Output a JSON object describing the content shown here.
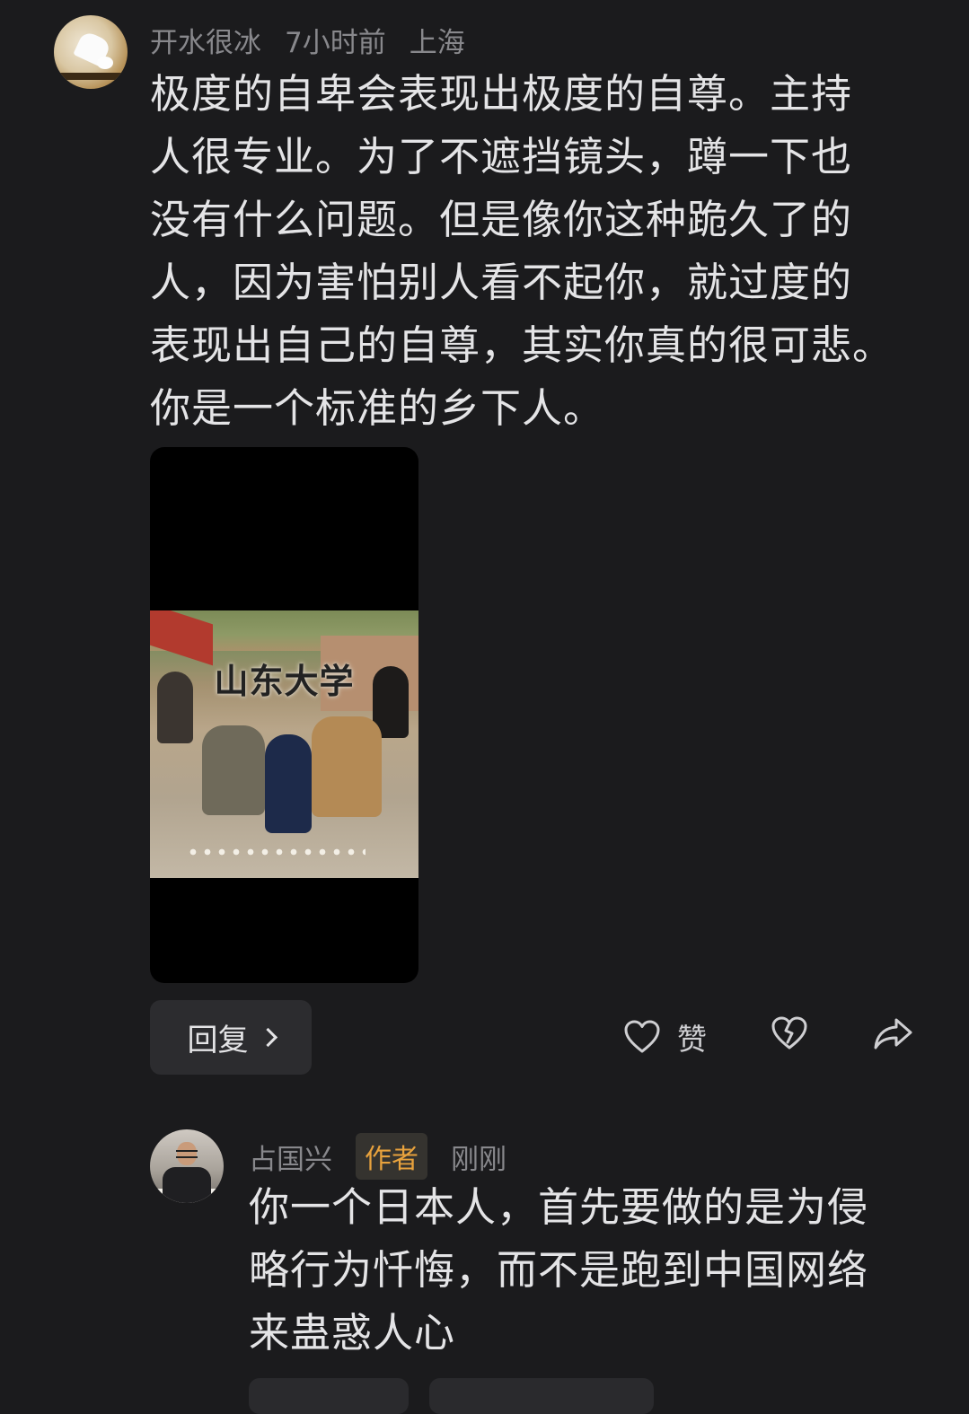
{
  "comment": {
    "author": "开水很冰",
    "time": "7小时前",
    "location": "上海",
    "lines": [
      "极度的自卑会表现出极度的自尊。主持",
      "人很专业。为了不遮挡镜头，蹲一下也",
      "没有什么问题。但是像你这种跪久了的",
      "人，因为害怕别人看不起你，就过度的",
      "表现出自己的自尊，其实你真的很可悲。",
      "你是一个标准的乡下人。"
    ],
    "media_caption": "山东大学",
    "avatar_icon": "badminton-shuttlecock-avatar"
  },
  "actions": {
    "reply_label": "回复",
    "like_label": "赞",
    "like_icon": "heart-icon",
    "dislike_icon": "broken-heart-icon",
    "share_icon": "share-arrow-icon"
  },
  "reply": {
    "author": "占国兴",
    "badge": "作者",
    "time": "刚刚",
    "lines": [
      "你一个日本人，首先要做的是为侵",
      "略行为忏悔，而不是跑到中国网络",
      "来蛊惑人心"
    ],
    "avatar_icon": "man-portrait-avatar"
  },
  "colors": {
    "background": "#1b1b1d",
    "text": "#e4e4e6",
    "meta": "#88888c",
    "badge_text": "#e8a23d"
  }
}
